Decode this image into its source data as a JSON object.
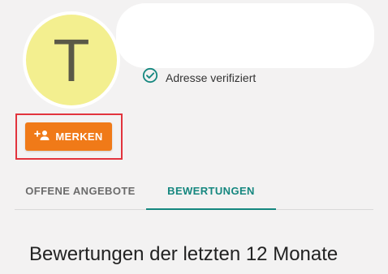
{
  "profile": {
    "avatar_initial": "T",
    "verified_label": "Adresse verifiziert",
    "follow_button_label": "MERKEN"
  },
  "tabs": [
    {
      "label": "OFFENE ANGEBOTE",
      "active": false
    },
    {
      "label": "BEWERTUNGEN",
      "active": true
    }
  ],
  "section": {
    "title": "Bewertungen der letzten 12 Monate"
  },
  "icons": {
    "verified": "check-circle-icon",
    "follow": "person-add-icon"
  },
  "colors": {
    "accent_orange": "#f07a18",
    "active_tab": "#15877f",
    "highlight_red": "#e2343d",
    "avatar_bg": "#f3ef8f"
  }
}
